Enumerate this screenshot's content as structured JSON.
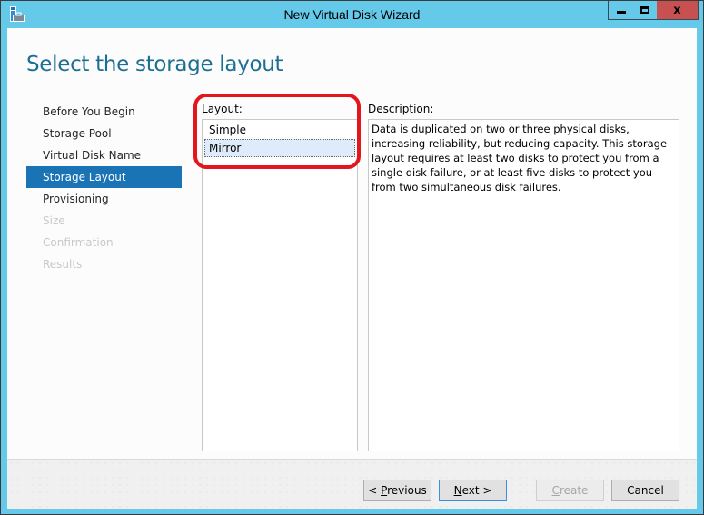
{
  "window": {
    "title": "New Virtual Disk Wizard",
    "controls": {
      "minimize": "minimize",
      "maximize": "maximize",
      "close": "x"
    },
    "colors": {
      "frame": "#65c9ea",
      "close_button": "#c75050",
      "accent": "#1a73b4",
      "title_text": "#1c6e93",
      "highlight_ring": "#e3151d"
    }
  },
  "page": {
    "title": "Select the storage layout"
  },
  "steps": [
    {
      "label": "Before You Begin",
      "state": "done"
    },
    {
      "label": "Storage Pool",
      "state": "done"
    },
    {
      "label": "Virtual Disk Name",
      "state": "done"
    },
    {
      "label": "Storage Layout",
      "state": "active"
    },
    {
      "label": "Provisioning",
      "state": "enabled"
    },
    {
      "label": "Size",
      "state": "disabled"
    },
    {
      "label": "Confirmation",
      "state": "disabled"
    },
    {
      "label": "Results",
      "state": "disabled"
    }
  ],
  "layout": {
    "label_mnemonic": "L",
    "label_rest": "ayout:",
    "options": [
      {
        "label": "Simple",
        "selected": false
      },
      {
        "label": "Mirror",
        "selected": true
      }
    ]
  },
  "description": {
    "label_mnemonic": "D",
    "label_rest": "escription:",
    "text": "Data is duplicated on two or three physical disks, increasing reliability, but reducing capacity. This storage layout requires at least two disks to protect you from a single disk failure, or at least five disks to protect you from two simultaneous disk failures."
  },
  "buttons": {
    "previous": {
      "prefix": "< ",
      "mnemonic": "P",
      "rest": "revious",
      "enabled": true
    },
    "next": {
      "mnemonic": "N",
      "rest": "ext >",
      "enabled": true,
      "default": true
    },
    "create": {
      "mnemonic": "C",
      "rest": "reate",
      "enabled": false
    },
    "cancel": {
      "label": "Cancel",
      "enabled": true
    }
  }
}
